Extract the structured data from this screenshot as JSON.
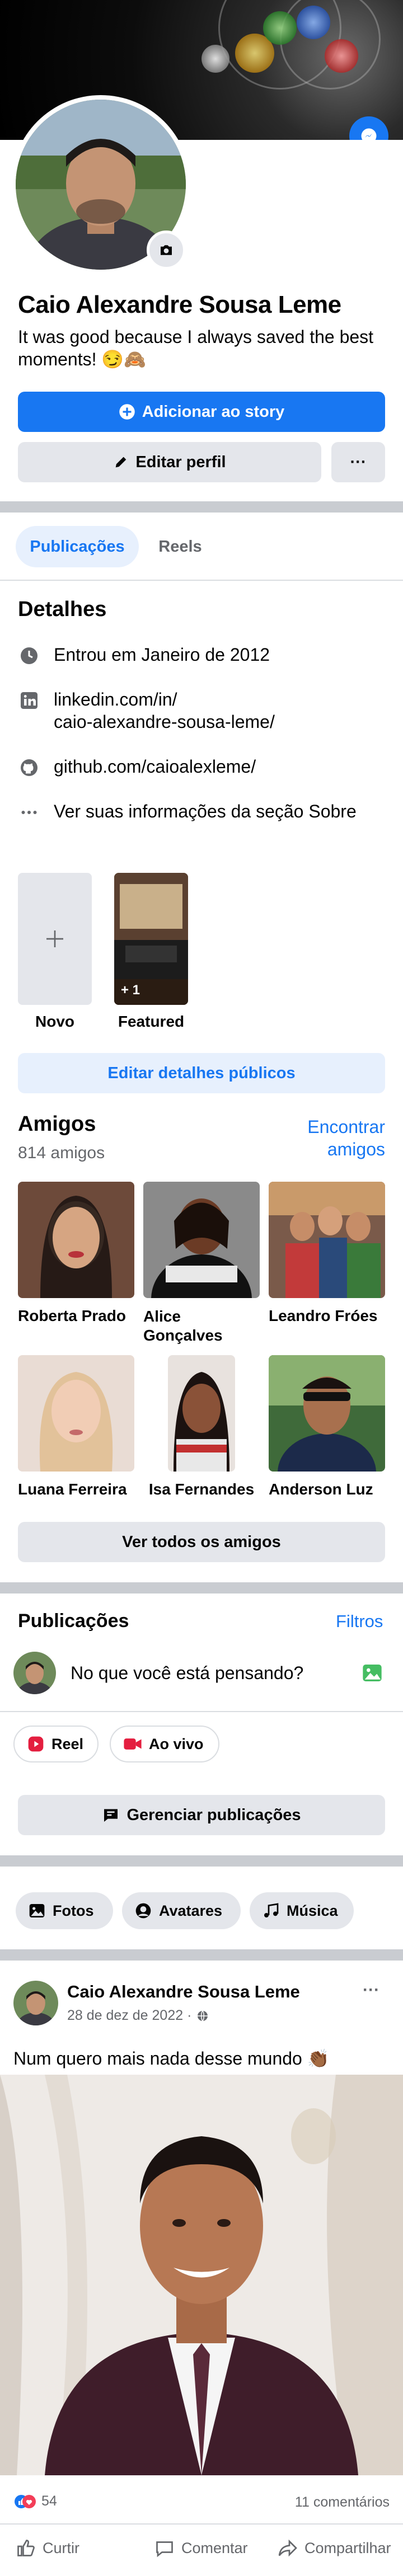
{
  "profile": {
    "name": "Caio Alexandre Sousa Leme",
    "bio": "It was good because I always saved the best moments! 😏🙈"
  },
  "actions": {
    "add_story": "Adicionar ao story",
    "edit_profile": "Editar perfil",
    "more": "···"
  },
  "tabs": [
    {
      "label": "Publicações",
      "active": true
    },
    {
      "label": "Reels",
      "active": false
    }
  ],
  "details": {
    "title": "Detalhes",
    "items": [
      {
        "icon": "clock-icon",
        "text": "Entrou em Janeiro de 2012"
      },
      {
        "icon": "linkedin-icon",
        "text": "linkedin.com/in/\ncaio-alexandre-sousa-leme/"
      },
      {
        "icon": "github-icon",
        "text": "github.com/caioalexleme/"
      },
      {
        "icon": "dots-icon",
        "text": "Ver suas informações da seção Sobre"
      }
    ]
  },
  "featured": {
    "new_label": "Novo",
    "featured_label": "Featured",
    "featured_count": "+ 1",
    "edit_details": "Editar detalhes públicos"
  },
  "friends": {
    "title": "Amigos",
    "count": "814 amigos",
    "find": "Encontrar amigos",
    "list": [
      {
        "name": "Roberta Prado"
      },
      {
        "name": "Alice Gonçalves"
      },
      {
        "name": "Leandro Fróes"
      },
      {
        "name": "Luana Ferreira"
      },
      {
        "name": "Isa Fernandes"
      },
      {
        "name": "Anderson Luz"
      }
    ],
    "see_all": "Ver todos os amigos"
  },
  "posts_section": {
    "title": "Publicações",
    "filters": "Filtros",
    "composer_placeholder": "No que você está pensando?",
    "reel": "Reel",
    "live": "Ao vivo",
    "manage": "Gerenciar publicações"
  },
  "media_tabs": {
    "photos": "Fotos",
    "avatars": "Avatares",
    "music": "Música"
  },
  "post": {
    "author": "Caio Alexandre Sousa Leme",
    "date": "28 de dez de 2022 ·",
    "text": "Num quero mais nada desse mundo 👏🏾",
    "reactions": "54",
    "comments": "11 comentários",
    "like": "Curtir",
    "comment": "Comentar",
    "share": "Compartilhar",
    "more": "···"
  },
  "colors": {
    "accent": "#1877f2",
    "button_gray": "#e4e6eb",
    "separator": "#c9ccd1",
    "text_secondary": "#65676b"
  }
}
